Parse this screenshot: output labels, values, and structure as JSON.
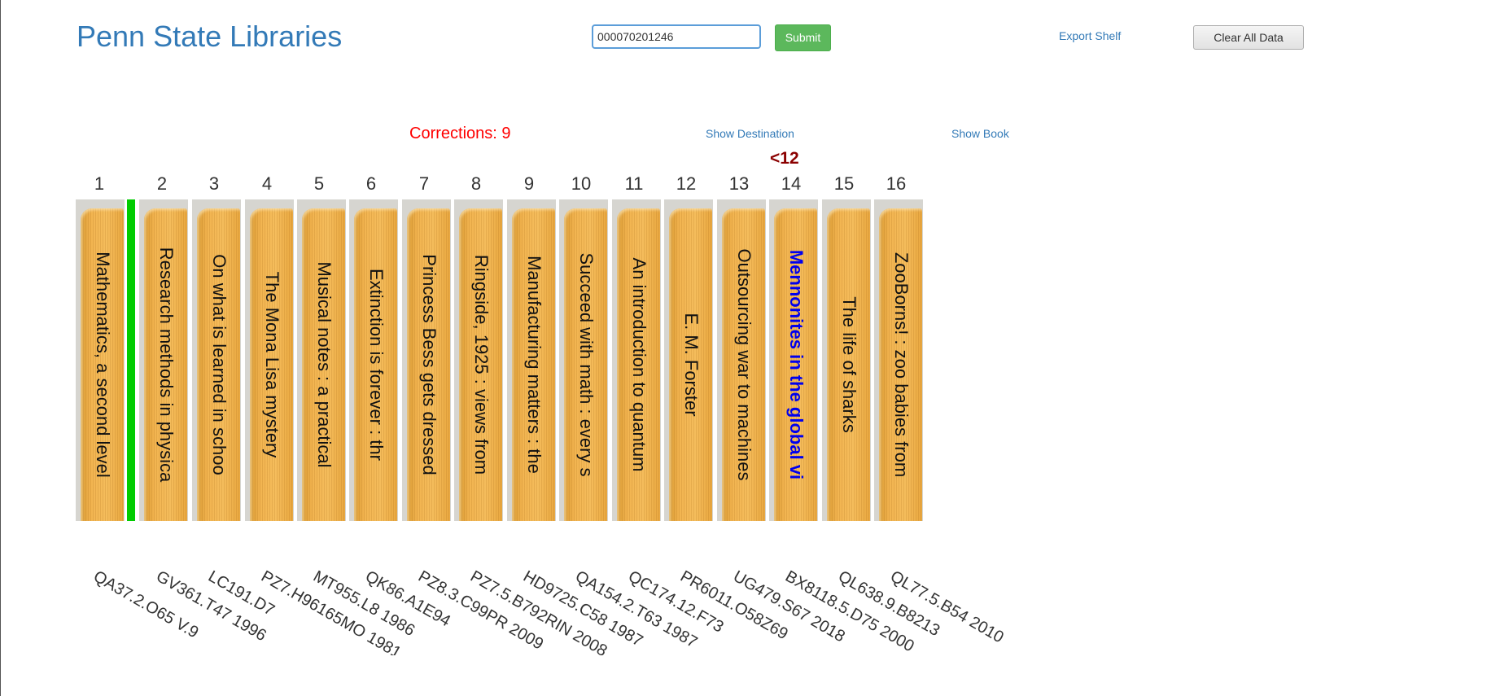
{
  "header": {
    "brand": "Penn State Libraries",
    "barcode_value": "000070201246",
    "submit_label": "Submit",
    "export_label": "Export Shelf",
    "clear_label": "Clear All Data"
  },
  "status": {
    "corrections": "Corrections: 9",
    "show_destination": "Show Destination",
    "show_book": "Show Book",
    "marker": "<12"
  },
  "colors": {
    "brand": "#337ab7",
    "submit": "#5cb85c",
    "corrections": "#ff0000",
    "marker": "#8b0000",
    "highlight_title": "#0000ee",
    "green_marker": "#00cc00"
  },
  "shelf": {
    "positions": [
      "1",
      "2",
      "3",
      "4",
      "5",
      "6",
      "7",
      "8",
      "9",
      "10",
      "11",
      "12",
      "13",
      "14",
      "15",
      "16"
    ],
    "books": [
      {
        "title": "Mathematics, a second level",
        "callno": "QA37.2.O65 V.9"
      },
      {
        "title": "Research methods in physica",
        "callno": "GV361.T47 1996"
      },
      {
        "title": "On what is learned in schoo",
        "callno": "LC191.D7"
      },
      {
        "title": "The Mona Lisa mystery",
        "callno": "PZ7.H96165MO 1981"
      },
      {
        "title": "Musical notes : a practical",
        "callno": "MT955.L8 1986"
      },
      {
        "title": "Extinction is forever : thr",
        "callno": "QK86.A1E94"
      },
      {
        "title": "Princess Bess gets dressed",
        "callno": "PZ8.3.C99PR 2009"
      },
      {
        "title": "Ringside, 1925 : views from",
        "callno": "PZ7.5.B792RIN 2008"
      },
      {
        "title": "Manufacturing matters : the",
        "callno": "HD9725.C58 1987"
      },
      {
        "title": "Succeed with math : every s",
        "callno": "QA154.2.T63 1987"
      },
      {
        "title": "An introduction to quantum",
        "callno": "QC174.12.F73"
      },
      {
        "title": "E. M. Forster",
        "callno": "PR6011.O58Z69"
      },
      {
        "title": "Outsourcing war to machines",
        "callno": "UG479.S67 2018"
      },
      {
        "title": "Mennonites in the global vi",
        "callno": "BX8118.5.D75 2000",
        "highlight": true
      },
      {
        "title": "The life of sharks",
        "callno": "QL638.9.B8213"
      },
      {
        "title": "ZooBorns! : zoo babies from",
        "callno": "QL77.5.B54 2010"
      }
    ]
  }
}
